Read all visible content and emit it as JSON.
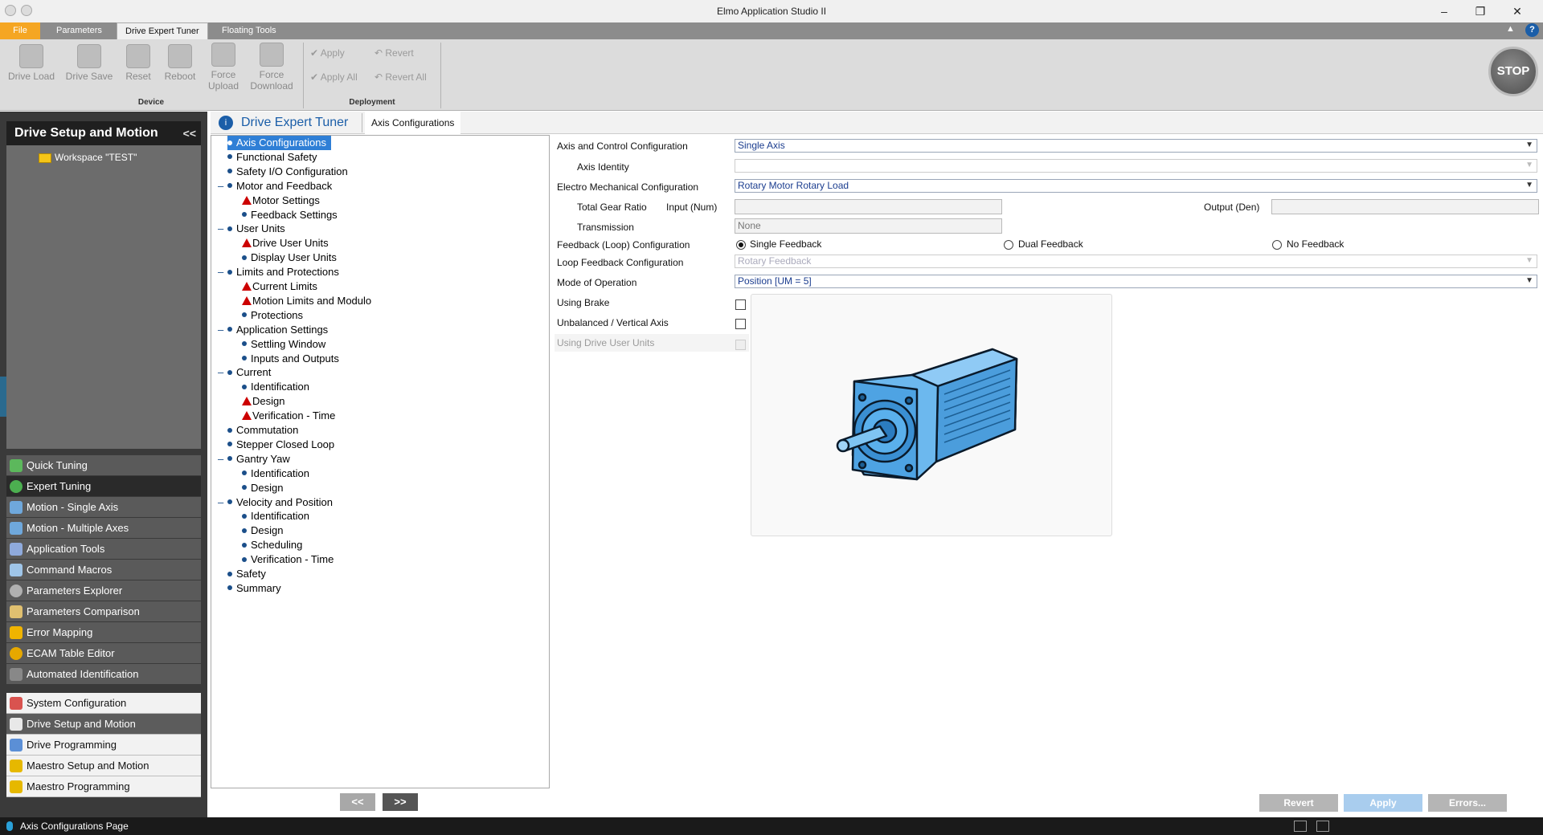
{
  "window": {
    "title": "Elmo Application Studio II",
    "minimize": "–",
    "restore": "❐",
    "close": "✕",
    "help": "?",
    "ribbon_toggle": "▲"
  },
  "tabs": {
    "file": "File",
    "items": [
      "Parameters",
      "Drive Expert Tuner",
      "Floating Tools"
    ]
  },
  "ribbon": {
    "device": {
      "label": "Device",
      "buttons": [
        "Drive Load",
        "Drive Save",
        "Reset",
        "Reboot",
        "Force Upload",
        "Force Download"
      ]
    },
    "deployment": {
      "label": "Deployment",
      "apply": "Apply",
      "apply_all": "Apply All",
      "revert": "Revert",
      "revert_all": "Revert All"
    },
    "stop": "STOP"
  },
  "left_panel": {
    "title": "Drive Setup and Motion",
    "collapse": "<<",
    "workspace": "Workspace \"TEST\"",
    "nav": [
      "Quick Tuning",
      "Expert Tuning",
      "Motion - Single Axis",
      "Motion - Multiple Axes",
      "Application Tools",
      "Command Macros",
      "Parameters Explorer",
      "Parameters Comparison",
      "Error Mapping",
      "ECAM Table Editor",
      "Automated Identification"
    ],
    "bottom_nav": [
      "System Configuration",
      "Drive Setup and Motion",
      "Drive Programming",
      "Maestro Setup and Motion",
      "Maestro Programming"
    ]
  },
  "header": {
    "title": "Drive Expert Tuner",
    "breadcrumb": "Axis Configurations"
  },
  "tree": [
    {
      "label": "Axis Configurations",
      "level": 0,
      "icon": "dot",
      "selected": true
    },
    {
      "label": "Functional Safety",
      "level": 0,
      "icon": "dot"
    },
    {
      "label": "Safety I/O Configuration",
      "level": 0,
      "icon": "dot"
    },
    {
      "label": "Motor and Feedback",
      "level": 0,
      "icon": "dot",
      "expand": "–"
    },
    {
      "label": "Motor Settings",
      "level": 1,
      "icon": "warning"
    },
    {
      "label": "Feedback Settings",
      "level": 1,
      "icon": "dot"
    },
    {
      "label": "User Units",
      "level": 0,
      "icon": "dot",
      "expand": "–"
    },
    {
      "label": "Drive User Units",
      "level": 1,
      "icon": "warning"
    },
    {
      "label": "Display User Units",
      "level": 1,
      "icon": "dot"
    },
    {
      "label": "Limits and Protections",
      "level": 0,
      "icon": "dot",
      "expand": "–"
    },
    {
      "label": "Current Limits",
      "level": 1,
      "icon": "warning"
    },
    {
      "label": "Motion Limits and Modulo",
      "level": 1,
      "icon": "warning"
    },
    {
      "label": "Protections",
      "level": 1,
      "icon": "dot"
    },
    {
      "label": "Application Settings",
      "level": 0,
      "icon": "dot",
      "expand": "–"
    },
    {
      "label": "Settling Window",
      "level": 1,
      "icon": "dot"
    },
    {
      "label": "Inputs and Outputs",
      "level": 1,
      "icon": "dot"
    },
    {
      "label": "Current",
      "level": 0,
      "icon": "dot",
      "expand": "–"
    },
    {
      "label": "Identification",
      "level": 1,
      "icon": "dot"
    },
    {
      "label": "Design",
      "level": 1,
      "icon": "warning"
    },
    {
      "label": "Verification - Time",
      "level": 1,
      "icon": "warning"
    },
    {
      "label": "Commutation",
      "level": 0,
      "icon": "dot"
    },
    {
      "label": "Stepper Closed Loop",
      "level": 0,
      "icon": "dot"
    },
    {
      "label": "Gantry Yaw",
      "level": 0,
      "icon": "dot",
      "expand": "–"
    },
    {
      "label": "Identification",
      "level": 1,
      "icon": "dot"
    },
    {
      "label": "Design",
      "level": 1,
      "icon": "dot"
    },
    {
      "label": "Velocity and Position",
      "level": 0,
      "icon": "dot",
      "expand": "–"
    },
    {
      "label": "Identification",
      "level": 1,
      "icon": "dot"
    },
    {
      "label": "Design",
      "level": 1,
      "icon": "dot"
    },
    {
      "label": "Scheduling",
      "level": 1,
      "icon": "dot"
    },
    {
      "label": "Verification - Time",
      "level": 1,
      "icon": "dot"
    },
    {
      "label": "Safety",
      "level": 0,
      "icon": "dot"
    },
    {
      "label": "Summary",
      "level": 0,
      "icon": "dot"
    }
  ],
  "tree_nav": {
    "prev": "<<",
    "next": ">>"
  },
  "form": {
    "axis_control_label": "Axis and Control Configuration",
    "axis_control_value": "Single Axis",
    "axis_identity_label": "Axis Identity",
    "axis_identity_value": "",
    "electro_label": "Electro Mechanical Configuration",
    "electro_value": "Rotary Motor Rotary Load",
    "gear_label": "Total Gear Ratio",
    "input_label": "Input (Num)",
    "input_value": "",
    "output_label": "Output (Den)",
    "output_value": "",
    "transmission_label": "Transmission",
    "transmission_value": "None",
    "feedback_label": "Feedback (Loop) Configuration",
    "feedback_options": [
      "Single Feedback",
      "Dual Feedback",
      "No Feedback"
    ],
    "feedback_selected": "Single Feedback",
    "loop_feedback_label": "Loop Feedback Configuration",
    "loop_feedback_value": "Rotary Feedback",
    "mode_label": "Mode of Operation",
    "mode_value": "Position [UM = 5]",
    "brake_label": "Using Brake",
    "brake_checked": false,
    "unbalanced_label": "Unbalanced / Vertical Axis",
    "unbalanced_checked": false,
    "drive_units_label": "Using Drive User Units",
    "drive_units_checked": false
  },
  "buttons": {
    "revert": "Revert",
    "apply": "Apply",
    "errors": "Errors..."
  },
  "status": {
    "page": "Axis Configurations Page"
  },
  "colors": {
    "accent": "#2f7fd6",
    "title_blue": "#1b5ea8",
    "warning": "#c00000",
    "file_tab": "#f5a623"
  }
}
